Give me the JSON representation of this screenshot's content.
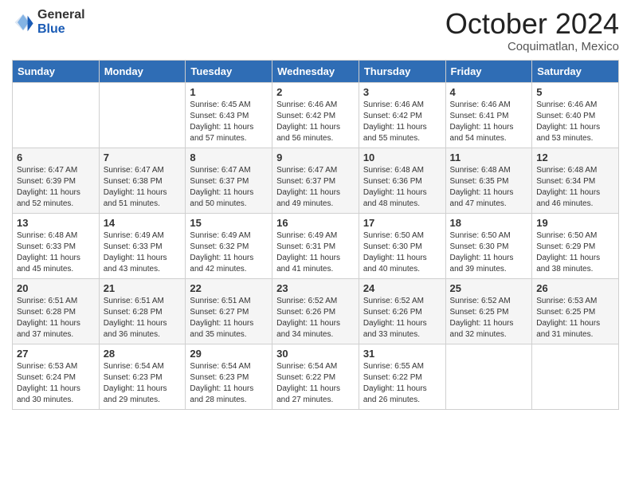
{
  "header": {
    "logo_general": "General",
    "logo_blue": "Blue",
    "month_title": "October 2024",
    "location": "Coquimatlan, Mexico"
  },
  "weekdays": [
    "Sunday",
    "Monday",
    "Tuesday",
    "Wednesday",
    "Thursday",
    "Friday",
    "Saturday"
  ],
  "weeks": [
    [
      {
        "day": "",
        "sunrise": "",
        "sunset": "",
        "daylight": ""
      },
      {
        "day": "",
        "sunrise": "",
        "sunset": "",
        "daylight": ""
      },
      {
        "day": "1",
        "sunrise": "Sunrise: 6:45 AM",
        "sunset": "Sunset: 6:43 PM",
        "daylight": "Daylight: 11 hours and 57 minutes."
      },
      {
        "day": "2",
        "sunrise": "Sunrise: 6:46 AM",
        "sunset": "Sunset: 6:42 PM",
        "daylight": "Daylight: 11 hours and 56 minutes."
      },
      {
        "day": "3",
        "sunrise": "Sunrise: 6:46 AM",
        "sunset": "Sunset: 6:42 PM",
        "daylight": "Daylight: 11 hours and 55 minutes."
      },
      {
        "day": "4",
        "sunrise": "Sunrise: 6:46 AM",
        "sunset": "Sunset: 6:41 PM",
        "daylight": "Daylight: 11 hours and 54 minutes."
      },
      {
        "day": "5",
        "sunrise": "Sunrise: 6:46 AM",
        "sunset": "Sunset: 6:40 PM",
        "daylight": "Daylight: 11 hours and 53 minutes."
      }
    ],
    [
      {
        "day": "6",
        "sunrise": "Sunrise: 6:47 AM",
        "sunset": "Sunset: 6:39 PM",
        "daylight": "Daylight: 11 hours and 52 minutes."
      },
      {
        "day": "7",
        "sunrise": "Sunrise: 6:47 AM",
        "sunset": "Sunset: 6:38 PM",
        "daylight": "Daylight: 11 hours and 51 minutes."
      },
      {
        "day": "8",
        "sunrise": "Sunrise: 6:47 AM",
        "sunset": "Sunset: 6:37 PM",
        "daylight": "Daylight: 11 hours and 50 minutes."
      },
      {
        "day": "9",
        "sunrise": "Sunrise: 6:47 AM",
        "sunset": "Sunset: 6:37 PM",
        "daylight": "Daylight: 11 hours and 49 minutes."
      },
      {
        "day": "10",
        "sunrise": "Sunrise: 6:48 AM",
        "sunset": "Sunset: 6:36 PM",
        "daylight": "Daylight: 11 hours and 48 minutes."
      },
      {
        "day": "11",
        "sunrise": "Sunrise: 6:48 AM",
        "sunset": "Sunset: 6:35 PM",
        "daylight": "Daylight: 11 hours and 47 minutes."
      },
      {
        "day": "12",
        "sunrise": "Sunrise: 6:48 AM",
        "sunset": "Sunset: 6:34 PM",
        "daylight": "Daylight: 11 hours and 46 minutes."
      }
    ],
    [
      {
        "day": "13",
        "sunrise": "Sunrise: 6:48 AM",
        "sunset": "Sunset: 6:33 PM",
        "daylight": "Daylight: 11 hours and 45 minutes."
      },
      {
        "day": "14",
        "sunrise": "Sunrise: 6:49 AM",
        "sunset": "Sunset: 6:33 PM",
        "daylight": "Daylight: 11 hours and 43 minutes."
      },
      {
        "day": "15",
        "sunrise": "Sunrise: 6:49 AM",
        "sunset": "Sunset: 6:32 PM",
        "daylight": "Daylight: 11 hours and 42 minutes."
      },
      {
        "day": "16",
        "sunrise": "Sunrise: 6:49 AM",
        "sunset": "Sunset: 6:31 PM",
        "daylight": "Daylight: 11 hours and 41 minutes."
      },
      {
        "day": "17",
        "sunrise": "Sunrise: 6:50 AM",
        "sunset": "Sunset: 6:30 PM",
        "daylight": "Daylight: 11 hours and 40 minutes."
      },
      {
        "day": "18",
        "sunrise": "Sunrise: 6:50 AM",
        "sunset": "Sunset: 6:30 PM",
        "daylight": "Daylight: 11 hours and 39 minutes."
      },
      {
        "day": "19",
        "sunrise": "Sunrise: 6:50 AM",
        "sunset": "Sunset: 6:29 PM",
        "daylight": "Daylight: 11 hours and 38 minutes."
      }
    ],
    [
      {
        "day": "20",
        "sunrise": "Sunrise: 6:51 AM",
        "sunset": "Sunset: 6:28 PM",
        "daylight": "Daylight: 11 hours and 37 minutes."
      },
      {
        "day": "21",
        "sunrise": "Sunrise: 6:51 AM",
        "sunset": "Sunset: 6:28 PM",
        "daylight": "Daylight: 11 hours and 36 minutes."
      },
      {
        "day": "22",
        "sunrise": "Sunrise: 6:51 AM",
        "sunset": "Sunset: 6:27 PM",
        "daylight": "Daylight: 11 hours and 35 minutes."
      },
      {
        "day": "23",
        "sunrise": "Sunrise: 6:52 AM",
        "sunset": "Sunset: 6:26 PM",
        "daylight": "Daylight: 11 hours and 34 minutes."
      },
      {
        "day": "24",
        "sunrise": "Sunrise: 6:52 AM",
        "sunset": "Sunset: 6:26 PM",
        "daylight": "Daylight: 11 hours and 33 minutes."
      },
      {
        "day": "25",
        "sunrise": "Sunrise: 6:52 AM",
        "sunset": "Sunset: 6:25 PM",
        "daylight": "Daylight: 11 hours and 32 minutes."
      },
      {
        "day": "26",
        "sunrise": "Sunrise: 6:53 AM",
        "sunset": "Sunset: 6:25 PM",
        "daylight": "Daylight: 11 hours and 31 minutes."
      }
    ],
    [
      {
        "day": "27",
        "sunrise": "Sunrise: 6:53 AM",
        "sunset": "Sunset: 6:24 PM",
        "daylight": "Daylight: 11 hours and 30 minutes."
      },
      {
        "day": "28",
        "sunrise": "Sunrise: 6:54 AM",
        "sunset": "Sunset: 6:23 PM",
        "daylight": "Daylight: 11 hours and 29 minutes."
      },
      {
        "day": "29",
        "sunrise": "Sunrise: 6:54 AM",
        "sunset": "Sunset: 6:23 PM",
        "daylight": "Daylight: 11 hours and 28 minutes."
      },
      {
        "day": "30",
        "sunrise": "Sunrise: 6:54 AM",
        "sunset": "Sunset: 6:22 PM",
        "daylight": "Daylight: 11 hours and 27 minutes."
      },
      {
        "day": "31",
        "sunrise": "Sunrise: 6:55 AM",
        "sunset": "Sunset: 6:22 PM",
        "daylight": "Daylight: 11 hours and 26 minutes."
      },
      {
        "day": "",
        "sunrise": "",
        "sunset": "",
        "daylight": ""
      },
      {
        "day": "",
        "sunrise": "",
        "sunset": "",
        "daylight": ""
      }
    ]
  ]
}
